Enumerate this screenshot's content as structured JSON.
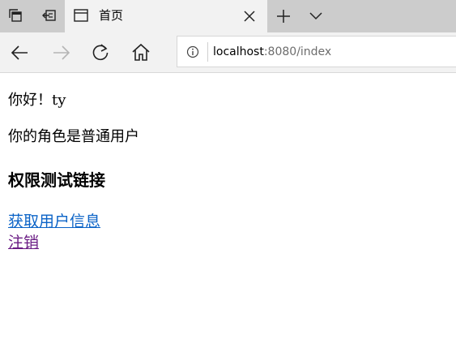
{
  "browser": {
    "tab": {
      "title": "首页"
    },
    "address": {
      "host": "localhost",
      "rest": ":8080/index"
    }
  },
  "page": {
    "greeting": "你好！ty",
    "role": "你的角色是普通用户",
    "section_heading": "权限测试链接",
    "links": {
      "user_info": "获取用户信息",
      "logout": "注销"
    }
  },
  "colors": {
    "tabstrip": "#cccccc",
    "chrome": "#f2f2f2",
    "link": "#0b63c7",
    "visited_link": "#6a1b84"
  }
}
